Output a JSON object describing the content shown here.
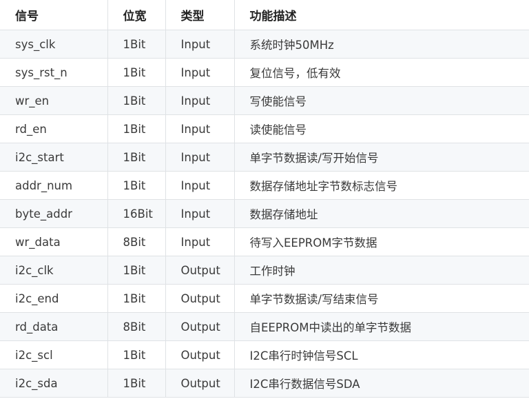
{
  "table": {
    "headers": [
      "信号",
      "位宽",
      "类型",
      "功能描述"
    ],
    "rows": [
      [
        "sys_clk",
        "1Bit",
        "Input",
        "系统时钟50MHz"
      ],
      [
        "sys_rst_n",
        "1Bit",
        "Input",
        "复位信号，低有效"
      ],
      [
        "wr_en",
        "1Bit",
        "Input",
        "写使能信号"
      ],
      [
        "rd_en",
        "1Bit",
        "Input",
        "读使能信号"
      ],
      [
        "i2c_start",
        "1Bit",
        "Input",
        "单字节数据读/写开始信号"
      ],
      [
        "addr_num",
        "1Bit",
        "Input",
        "数据存储地址字节数标志信号"
      ],
      [
        "byte_addr",
        "16Bit",
        "Input",
        "数据存储地址"
      ],
      [
        "wr_data",
        "8Bit",
        "Input",
        "待写入EEPROM字节数据"
      ],
      [
        "i2c_clk",
        "1Bit",
        "Output",
        "工作时钟"
      ],
      [
        "i2c_end",
        "1Bit",
        "Output",
        "单字节数据读/写结束信号"
      ],
      [
        "rd_data",
        "8Bit",
        "Output",
        "自EEPROM中读出的单字节数据"
      ],
      [
        "i2c_scl",
        "1Bit",
        "Output",
        "I2C串行时钟信号SCL"
      ],
      [
        "i2c_sda",
        "1Bit",
        "Output",
        "I2C串行数据信号SDA"
      ]
    ]
  }
}
